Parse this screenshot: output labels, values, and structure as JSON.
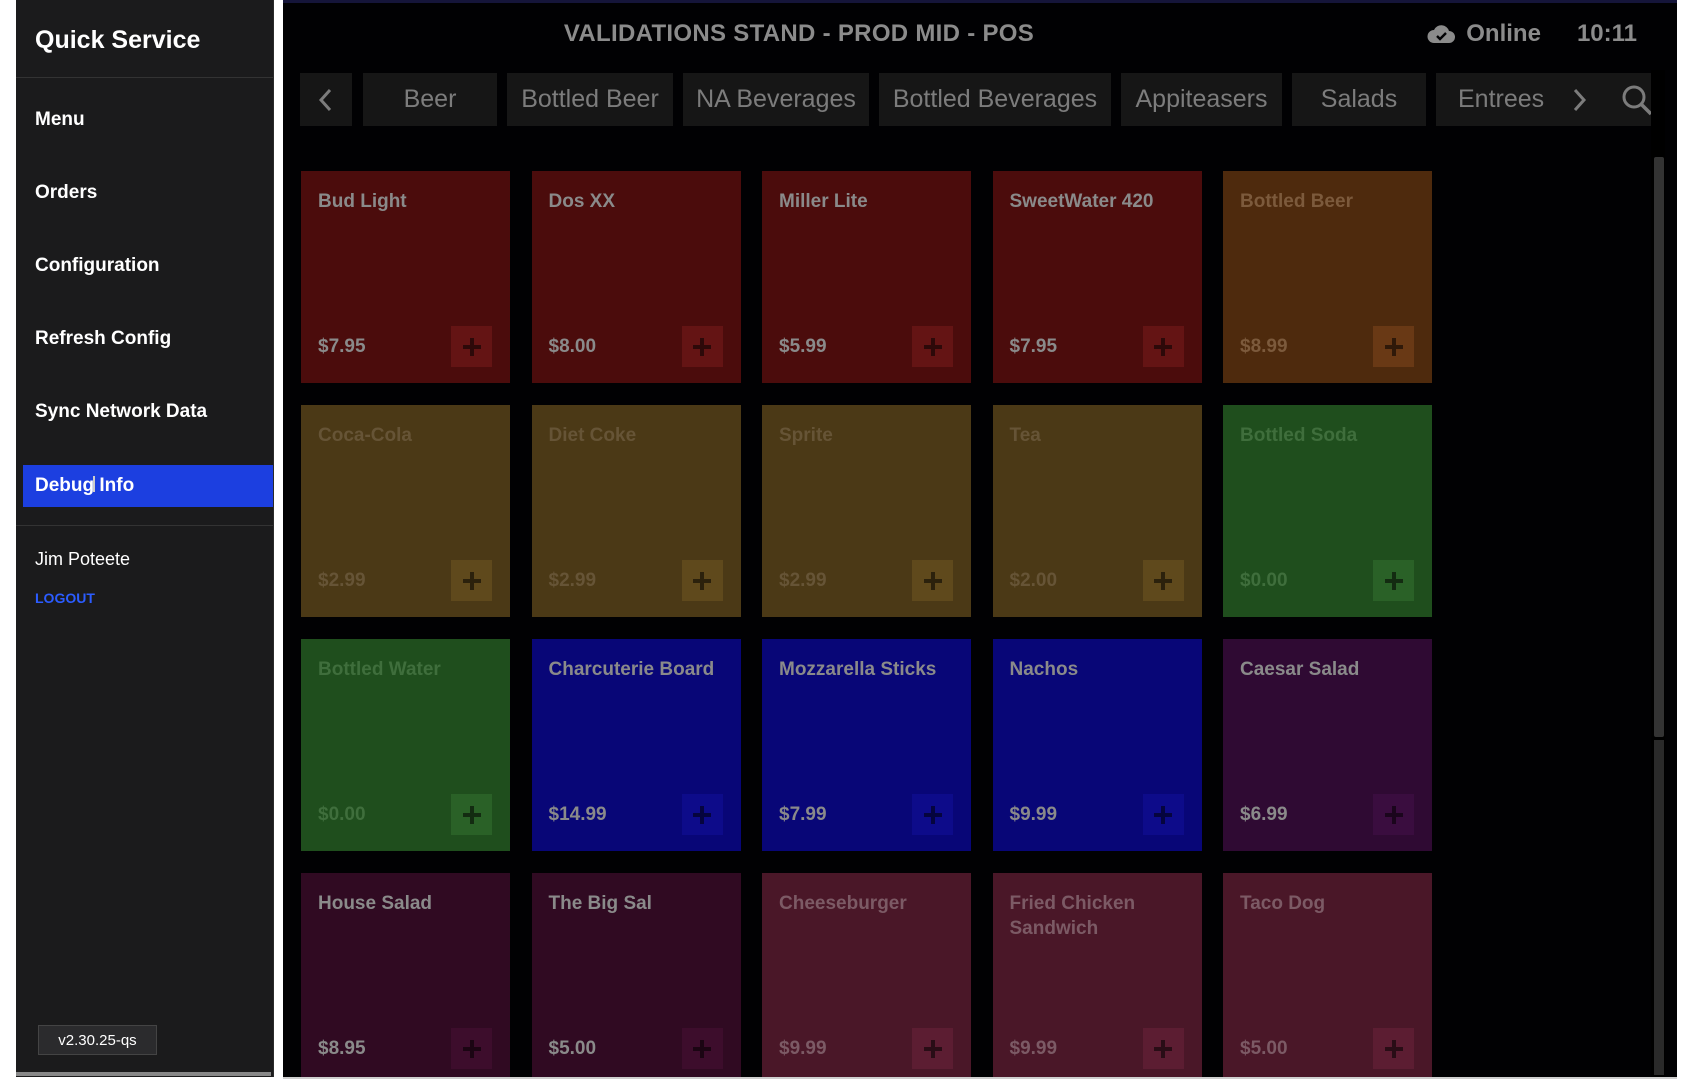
{
  "sidebar": {
    "title": "Quick Service",
    "items": [
      {
        "label": "Menu"
      },
      {
        "label": "Orders"
      },
      {
        "label": "Configuration"
      },
      {
        "label": "Refresh Config"
      },
      {
        "label": "Sync Network Data"
      },
      {
        "label": "Debug Info",
        "active": true
      }
    ],
    "user_name": "Jim Poteete",
    "logout_label": "LOGOUT",
    "version": "v2.30.25-qs"
  },
  "header": {
    "title": "VALIDATIONS STAND - PROD MID - POS",
    "status": "Online",
    "time": "10:11",
    "status_icon": "cloud-icon"
  },
  "categories": {
    "tabs": [
      "Beer",
      "Bottled Beer",
      "NA Beverages",
      "Bottled Beverages",
      "Appiteasers",
      "Salads",
      "Entrees"
    ],
    "prev_icon": "chevron-left-icon",
    "next_icon": "chevron-right-icon",
    "search_icon": "search-icon"
  },
  "menu_items": [
    {
      "name": "Bud Light",
      "price": "$7.95",
      "color": "red"
    },
    {
      "name": "Dos XX",
      "price": "$8.00",
      "color": "red"
    },
    {
      "name": "Miller Lite",
      "price": "$5.99",
      "color": "red"
    },
    {
      "name": "SweetWater 420",
      "price": "$7.95",
      "color": "red"
    },
    {
      "name": "Bottled Beer",
      "price": "$8.99",
      "color": "orange"
    },
    {
      "name": "Coca-Cola",
      "price": "$2.99",
      "color": "yellow"
    },
    {
      "name": "Diet Coke",
      "price": "$2.99",
      "color": "yellow"
    },
    {
      "name": "Sprite",
      "price": "$2.99",
      "color": "yellow"
    },
    {
      "name": "Tea",
      "price": "$2.00",
      "color": "yellow"
    },
    {
      "name": "Bottled Soda",
      "price": "$0.00",
      "color": "green"
    },
    {
      "name": "Bottled Water",
      "price": "$0.00",
      "color": "green"
    },
    {
      "name": "Charcuterie Board",
      "price": "$14.99",
      "color": "blue"
    },
    {
      "name": "Mozzarella Sticks",
      "price": "$7.99",
      "color": "blue"
    },
    {
      "name": "Nachos",
      "price": "$9.99",
      "color": "blue"
    },
    {
      "name": "Caesar Salad",
      "price": "$6.99",
      "color": "purple"
    },
    {
      "name": "House Salad",
      "price": "$8.95",
      "color": "plum"
    },
    {
      "name": "The Big Sal",
      "price": "$5.00",
      "color": "plum"
    },
    {
      "name": "Cheeseburger",
      "price": "$9.99",
      "color": "rose"
    },
    {
      "name": "Fried Chicken Sandwich",
      "price": "$9.99",
      "color": "rose"
    },
    {
      "name": "Taco Dog",
      "price": "$5.00",
      "color": "rose"
    }
  ],
  "add_icon": "plus-icon"
}
